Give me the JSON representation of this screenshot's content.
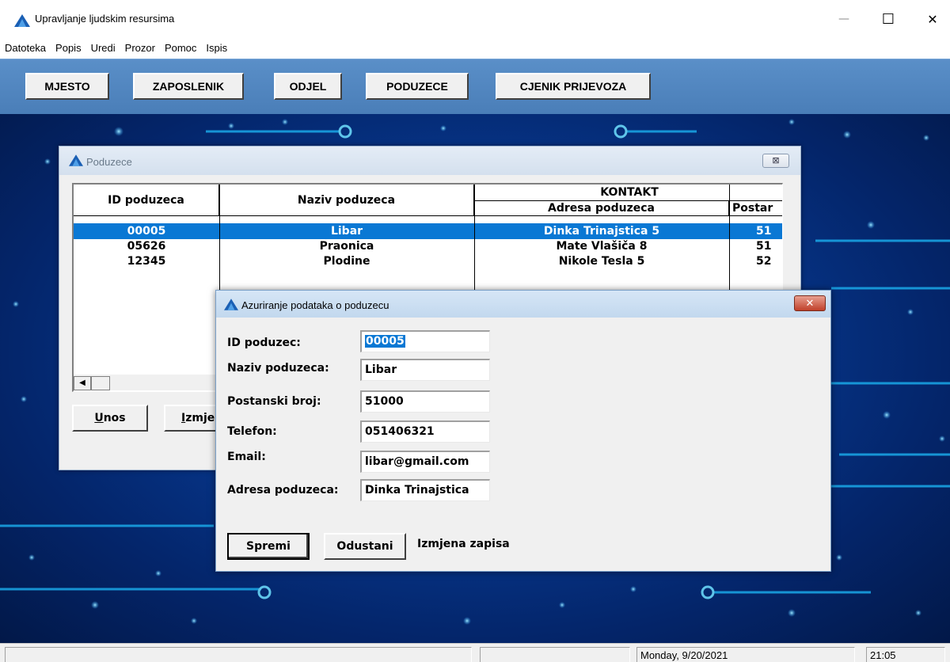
{
  "window": {
    "title": "Upravljanje ljudskim resursima",
    "minimize": "—",
    "maximize": "☐",
    "close": "✕"
  },
  "menu": [
    "Datoteka",
    "Popis",
    "Uredi",
    "Prozor",
    "Pomoc",
    "Ispis"
  ],
  "toolbar": [
    "MJESTO",
    "ZAPOSLENIK",
    "ODJEL",
    "PODUZECE",
    "CJENIK PRIJEVOZA"
  ],
  "poduzece_window": {
    "title": "Poduzece",
    "close": "⊠",
    "grid": {
      "headers": {
        "id": "ID poduzeca",
        "naziv": "Naziv poduzeca",
        "kontakt": "KONTAKT",
        "adresa": "Adresa poduzeca",
        "postar": "Postar"
      },
      "rows": [
        {
          "id": "00005",
          "naziv": "Libar",
          "adresa": "Dinka Trinajstica 5",
          "post": "51"
        },
        {
          "id": "05626",
          "naziv": "Praonica",
          "adresa": "Mate Vlašiča 8",
          "post": "51"
        },
        {
          "id": "12345",
          "naziv": "Plodine",
          "adresa": "Nikole Tesla 5",
          "post": "52"
        }
      ],
      "selected_row": 0
    },
    "buttons": {
      "unos_u": "U",
      "unos_rest": "nos",
      "izmjena_u": "I",
      "izmjena_rest": "zmje"
    }
  },
  "dialog": {
    "title": "Azuriranje podataka o poduzecu",
    "close": "✕",
    "fields": {
      "id_label": "ID poduzec:",
      "id_value": "00005",
      "naziv_label": "Naziv poduzeca:",
      "naziv_value": "Libar",
      "postanski_label": "Postanski broj:",
      "postanski_value": "51000",
      "telefon_label": "Telefon:",
      "telefon_value": "051406321",
      "email_label": "Email:",
      "email_value": "libar@gmail.com",
      "adresa_label": "Adresa poduzeca:",
      "adresa_value": "Dinka Trinajstica"
    },
    "spremi": "Spremi",
    "odustani": "Odustani",
    "status": "Izmjena zapisa"
  },
  "statusbar": {
    "date": "Monday, 9/20/2021",
    "time": "21:05"
  },
  "colors": {
    "selection": "#0a78d4",
    "toolbar": "#4a7eb8",
    "desktop": "#073a92"
  }
}
